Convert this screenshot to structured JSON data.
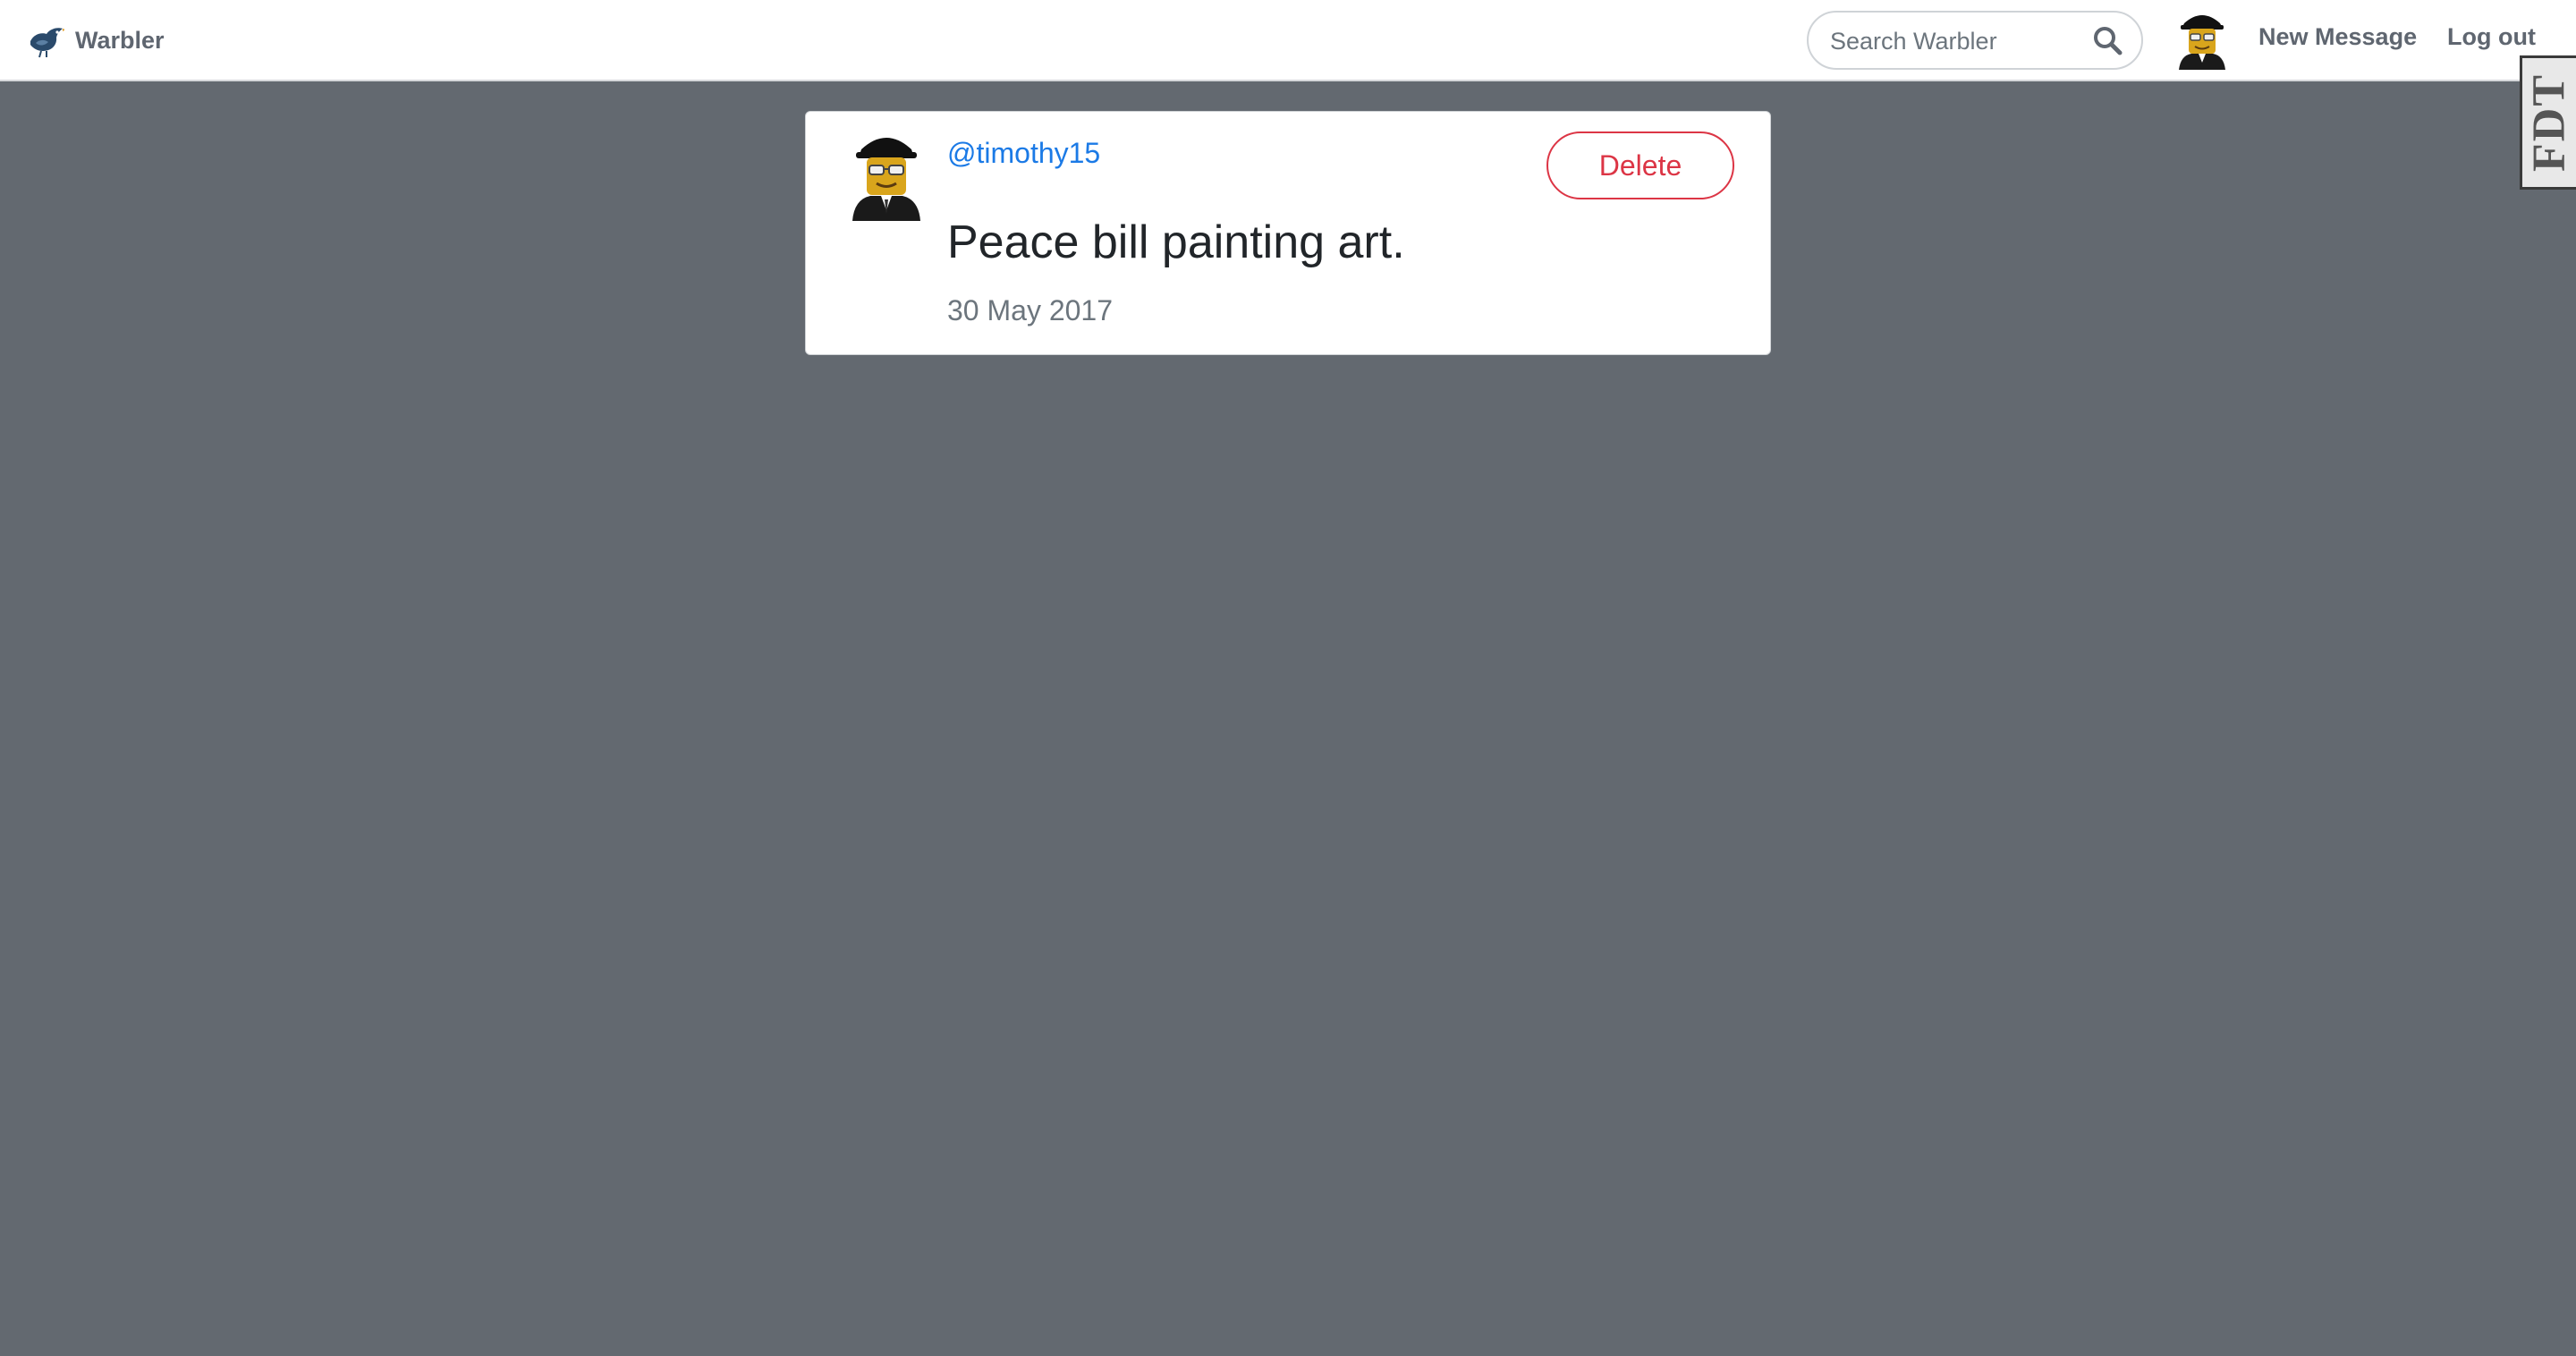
{
  "navbar": {
    "brand_name": "Warbler",
    "search_placeholder": "Search Warbler",
    "new_message_label": "New Message",
    "logout_label": "Log out",
    "debug_toolbar_label": "FDT"
  },
  "message": {
    "username": "@timothy15",
    "text": "Peace bill painting art.",
    "date": "30 May 2017",
    "delete_label": "Delete"
  },
  "colors": {
    "page_background": "#636970",
    "link": "#1b7ae6",
    "danger": "#dc3545",
    "nav_text": "#5f6670"
  },
  "icons": {
    "brand": "warbler-bird-icon",
    "search": "search-icon",
    "avatar": "user-avatar"
  }
}
